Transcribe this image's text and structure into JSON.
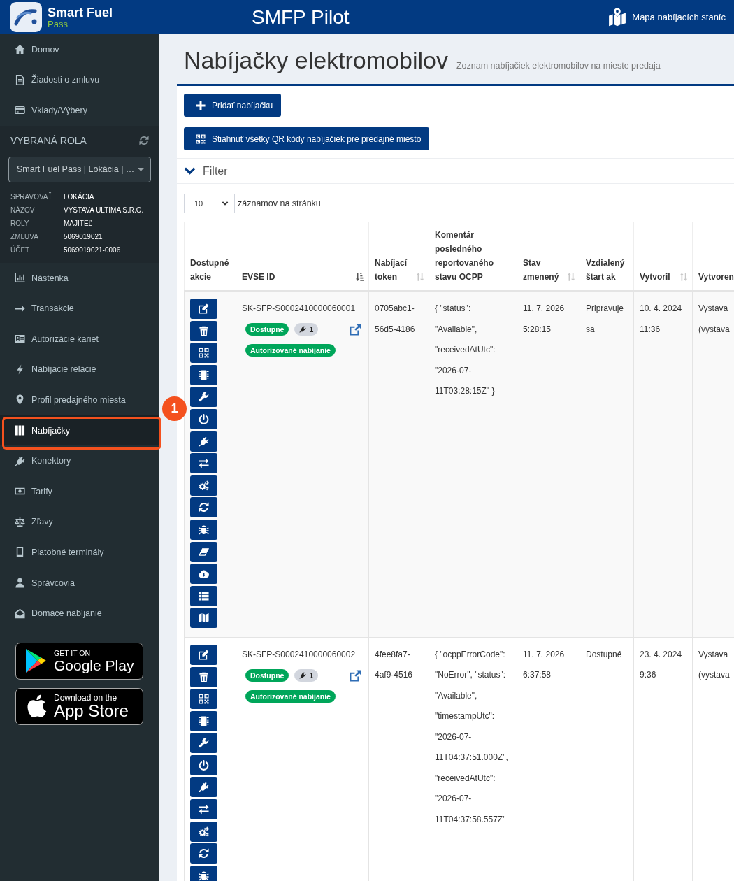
{
  "header": {
    "brand": "Smart Fuel",
    "brand_sub": "Pass",
    "title": "SMFP Pilot",
    "map_link": "Mapa nabíjacích staníc"
  },
  "sidebar": {
    "top_items": [
      {
        "label": "Domov",
        "selected": false
      },
      {
        "label": "Žiadosti o zmluvu",
        "selected": false
      },
      {
        "label": "Vklady/Výbery",
        "selected": false
      }
    ],
    "role": {
      "title": "VYBRANÁ ROLA",
      "value": "Smart Fuel Pass | Lokácia | …",
      "details": [
        {
          "label": "SPRAVOVAŤ",
          "value": "LOKÁCIA"
        },
        {
          "label": "NÁZOV",
          "value": "VYSTAVA ULTIMA S.R.O."
        },
        {
          "label": "ROLY",
          "value": "MAJITEĽ"
        },
        {
          "label": "ZMLUVA",
          "value": "5069019021"
        },
        {
          "label": "ÚČET",
          "value": "5069019021-0006"
        }
      ]
    },
    "items": [
      {
        "label": "Nástenka",
        "selected": false
      },
      {
        "label": "Transakcie",
        "selected": false
      },
      {
        "label": "Autorizácie kariet",
        "selected": false
      },
      {
        "label": "Nabíjacie relácie",
        "selected": false
      },
      {
        "label": "Profil predajného miesta",
        "selected": false
      },
      {
        "label": "Nabíjačky",
        "selected": true
      },
      {
        "label": "Konektory",
        "selected": false
      },
      {
        "label": "Tarify",
        "selected": false
      },
      {
        "label": "Zľavy",
        "selected": false
      },
      {
        "label": "Platobné terminály",
        "selected": false
      },
      {
        "label": "Správcovia",
        "selected": false
      },
      {
        "label": "Domáce nabíjanie",
        "selected": false
      }
    ],
    "store_badges": [
      {
        "kind": "google",
        "caption": "GET IT ON",
        "name": "Google Play"
      },
      {
        "kind": "apple",
        "caption": "Download on the",
        "name": "App Store"
      }
    ]
  },
  "annotation": {
    "marker": "1"
  },
  "page": {
    "title": "Nabíjačky elektromobilov",
    "subtitle": "Zoznam nabíjačiek elektromobilov na mieste predaja"
  },
  "toolbar": [
    {
      "kind": "add",
      "label": "Pridať nabíjačku"
    },
    {
      "kind": "qr",
      "label": "Stiahnuť všetky QR kódy nabíjačiek pre predajné miesto"
    }
  ],
  "filter": {
    "label": "Filter",
    "expanded": false
  },
  "page_size": {
    "value": "10",
    "label": "záznamov na stránku"
  },
  "table": {
    "columns": [
      {
        "label": "Dostupné akcie",
        "sortable": false,
        "sorted": false
      },
      {
        "label": "EVSE ID",
        "sortable": true,
        "sorted": true
      },
      {
        "label": "Nabíjací token",
        "sortable": true,
        "sorted": false
      },
      {
        "label": "Komentár posledného reportovaného stavu OCPP",
        "sortable": false,
        "sorted": false
      },
      {
        "label": "Stav zmenený",
        "sortable": true,
        "sorted": false
      },
      {
        "label": "Vzdialený štart ak",
        "sortable": false,
        "sorted": false
      },
      {
        "label": "Vytvoril",
        "sortable": true,
        "sorted": false
      },
      {
        "label": "Vytvoren",
        "sortable": false,
        "sorted": false
      }
    ],
    "rows": [
      {
        "actions": [
          {
            "kind": "edit"
          },
          {
            "kind": "delete"
          },
          {
            "kind": "qr"
          },
          {
            "kind": "chip"
          },
          {
            "kind": "wrench"
          },
          {
            "kind": "power"
          },
          {
            "kind": "plug"
          },
          {
            "kind": "swap"
          },
          {
            "kind": "gears"
          },
          {
            "kind": "sync"
          },
          {
            "kind": "bug"
          },
          {
            "kind": "eraser"
          },
          {
            "kind": "download"
          },
          {
            "kind": "list"
          },
          {
            "kind": "map"
          }
        ],
        "evse_id": "SK-SFP-S0002410000060001",
        "status": "Dostupné",
        "connectors": "1",
        "tags": [
          "Autorizované nabíjanie"
        ],
        "token": "0705abc1-56d5-4186",
        "comment": "{ \"status\": \"Available\", \"receivedAtUtc\": \"2026-07-11T03:28:15Z\" }",
        "state_changed": "11. 7. 2026 5:28:15",
        "remote_start": "Pripravuje sa",
        "created": "10. 4. 2024 11:36",
        "column_8": "Vystava (vystava"
      },
      {
        "actions": [
          {
            "kind": "edit"
          },
          {
            "kind": "delete"
          },
          {
            "kind": "qr"
          },
          {
            "kind": "chip"
          },
          {
            "kind": "wrench"
          },
          {
            "kind": "power"
          },
          {
            "kind": "plug"
          },
          {
            "kind": "swap"
          },
          {
            "kind": "gears"
          },
          {
            "kind": "sync"
          },
          {
            "kind": "bug"
          }
        ],
        "evse_id": "SK-SFP-S0002410000060002",
        "status": "Dostupné",
        "connectors": "1",
        "tags": [
          "Autorizované nabíjanie"
        ],
        "token": "4fee8fa7-4af9-4516",
        "comment": "{ \"ocppErrorCode\": \"NoError\", \"status\": \"Available\", \"timestampUtc\": \"2026-07-11T04:37:51.000Z\", \"receivedAtUtc\": \"2026-07-11T04:37:58.557Z\"",
        "state_changed": "11. 7. 2026 6:37:58",
        "remote_start": "Dostupné",
        "created": "23. 4. 2024 9:36",
        "column_8": "Vystava (vystava"
      }
    ]
  }
}
